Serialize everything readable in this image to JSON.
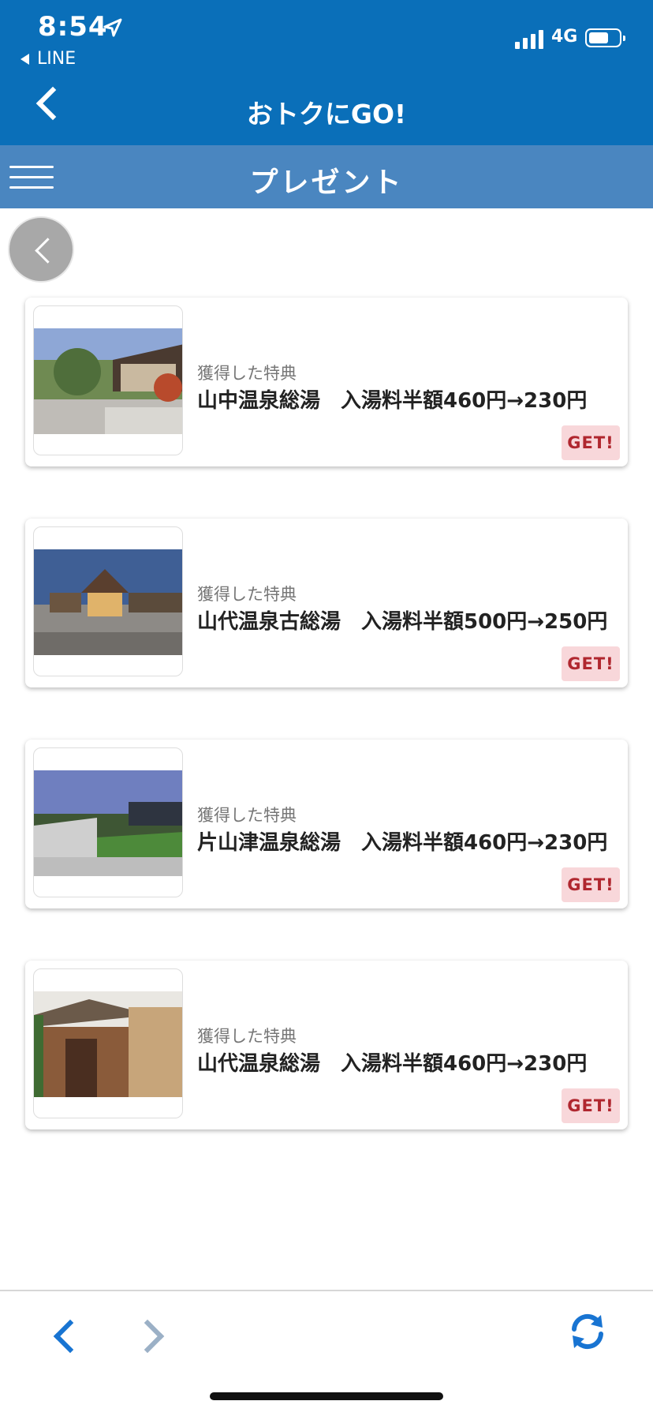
{
  "status": {
    "time": "8:54",
    "back_app": "LINE",
    "network": "4G"
  },
  "nav": {
    "title": "おトクにGO!"
  },
  "subnav": {
    "title": "プレゼント"
  },
  "items": [
    {
      "label": "獲得した特典",
      "name": "山中温泉総湯　入湯料半額460円→230円",
      "badge": "GET!"
    },
    {
      "label": "獲得した特典",
      "name": "山代温泉古総湯　入湯料半額500円→250円",
      "badge": "GET!"
    },
    {
      "label": "獲得した特典",
      "name": "片山津温泉総湯　入湯料半額460円→230円",
      "badge": "GET!"
    },
    {
      "label": "獲得した特典",
      "name": "山代温泉総湯　入湯料半額460円→230円",
      "badge": "GET!"
    }
  ],
  "colors": {
    "header": "#0a6fb9",
    "subheader": "#4a86c0",
    "badge_bg": "#f8d7da",
    "badge_text": "#b0272f",
    "toolbar_active": "#1874d2"
  },
  "icons": [
    "location-arrow-icon",
    "signal-icon",
    "battery-icon",
    "back-chevron-icon",
    "hamburger-icon",
    "refresh-icon"
  ]
}
